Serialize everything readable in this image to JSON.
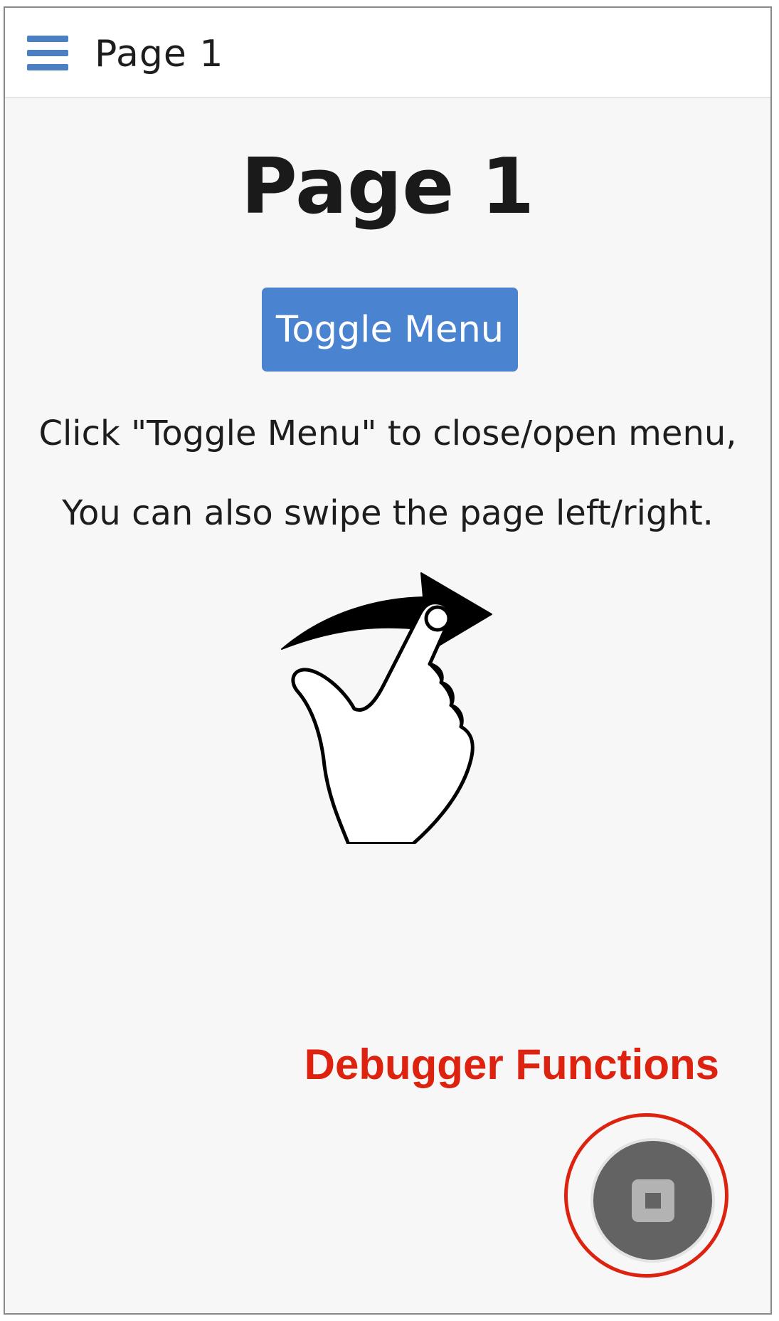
{
  "toolbar": {
    "title": "Page 1",
    "menu_icon": "hamburger-menu-icon",
    "accent_color": "#4a7fc1"
  },
  "main": {
    "heading": "Page 1",
    "toggle_button_label": "Toggle Menu",
    "toggle_button_color": "#4a83cf",
    "instruction_line1": "Click \"Toggle Menu\" to close/open menu,",
    "instruction_line2": "You can also swipe the page left/right.",
    "swipe_icon": "swipe-gesture-icon"
  },
  "debugger": {
    "label": "Debugger Functions",
    "label_color": "#dd2210",
    "button_icon": "stop-icon"
  }
}
